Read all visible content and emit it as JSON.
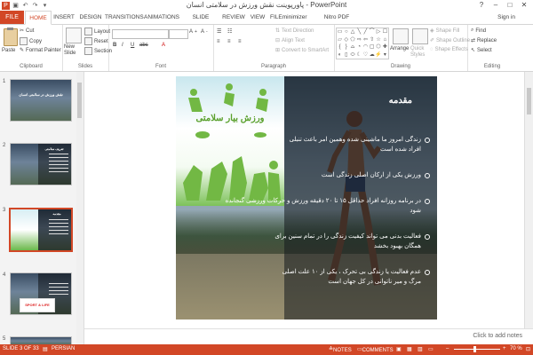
{
  "window": {
    "title": "پاورپوینت نقش ورزش در سلامتی انسان - PowerPoint",
    "sign_in": "Sign in",
    "controls": [
      "?",
      "–",
      "□",
      "✕"
    ]
  },
  "tabs": [
    "FILE",
    "HOME",
    "INSERT",
    "DESIGN",
    "TRANSITIONS",
    "ANIMATIONS",
    "SLIDE SHOW",
    "REVIEW",
    "VIEW",
    "FILEminimizer",
    "Nitro PDF Professional"
  ],
  "active_tab": "HOME",
  "ribbon": {
    "clipboard": {
      "label": "Clipboard",
      "paste": "Paste",
      "cut": "Cut",
      "copy": "Copy",
      "format_painter": "Format Painter"
    },
    "slides": {
      "label": "Slides",
      "new_slide": "New Slide",
      "layout": "Layout",
      "reset": "Reset",
      "section": "Section"
    },
    "font": {
      "label": "Font"
    },
    "paragraph": {
      "label": "Paragraph",
      "text_direction": "Text Direction",
      "align_text": "Align Text",
      "convert_smartart": "Convert to SmartArt"
    },
    "drawing": {
      "label": "Drawing",
      "arrange": "Arrange",
      "quick_styles": "Quick Styles",
      "shape_fill": "Shape Fill",
      "shape_outline": "Shape Outline",
      "shape_effects": "Shape Effects"
    },
    "editing": {
      "label": "Editing",
      "find": "Find",
      "replace": "Replace",
      "select": "Select"
    }
  },
  "thumbnails": [
    {
      "num": "1",
      "title": "نقش ورزش در سلامتی انسان"
    },
    {
      "num": "2",
      "title": "تعريف سلامتی"
    },
    {
      "num": "3",
      "title": "مقدمه"
    },
    {
      "num": "4",
      "title": "SPORT & LIFE"
    },
    {
      "num": "5",
      "title": ""
    }
  ],
  "selected_slide": 3,
  "slide": {
    "title": "مقدمه",
    "picture_title": "ورزش بیار سلامتی",
    "bullets": [
      "زندگی امروز ما ماشینی شده وهمین امر باعث تنبلی افراد شده است",
      "ورزش یکی از ارکان اصلی زندگی است",
      "در برنامه روزانه افراد حداقل ۱۵ تا ۲۰ دقیقه ورزش و حرکات ورزشی گنجانده شود",
      "فعالیت بدنی می تواند کیفیت زندگی را در تمام سنین برای همگان بهبود بخشد",
      "عدم فعالیت یا زندگی بی تحرک ، یکی از ۱۰ علت اصلی مرگ و میر ناتوانی در کل جهان است"
    ]
  },
  "notes_placeholder": "Click to add notes",
  "status": {
    "slide_info": "SLIDE 3 OF 33",
    "language": "PERSIAN",
    "notes": "NOTES",
    "comments": "COMMENTS",
    "zoom": "70 %"
  },
  "colors": {
    "accent": "#d24726",
    "picture_green": "#5aa02c"
  }
}
